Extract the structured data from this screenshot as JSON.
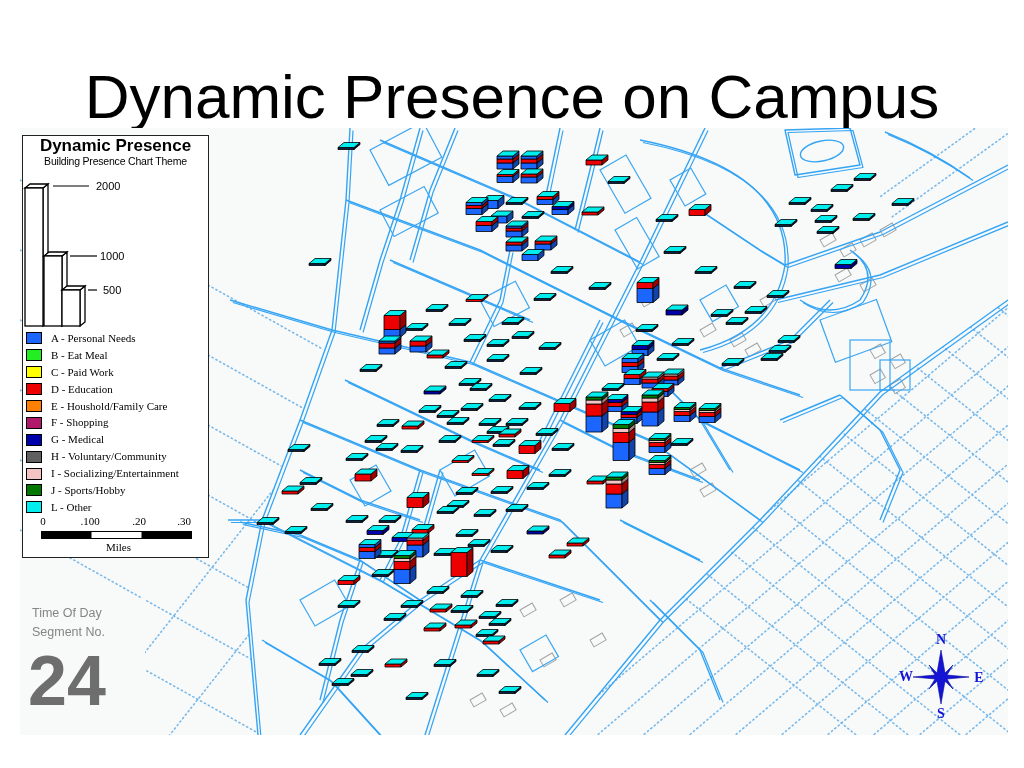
{
  "title": "Dynamic Presence on Campus",
  "legend": {
    "title": "Dynamic Presence",
    "subtitle": "Building Presence Chart Theme",
    "size_scale": [
      "2000",
      "1000",
      "500"
    ],
    "categories": [
      {
        "label": "A - Personal Needs",
        "color": "#1a66ff"
      },
      {
        "label": "B - Eat Meal",
        "color": "#22ee22"
      },
      {
        "label": "C - Paid Work",
        "color": "#ffff00"
      },
      {
        "label": "D - Education",
        "color": "#ee0000"
      },
      {
        "label": "E - Houshold/Family Care",
        "color": "#ff8000"
      },
      {
        "label": "F - Shopping",
        "color": "#b0186a"
      },
      {
        "label": "G - Medical",
        "color": "#0000aa"
      },
      {
        "label": "H - Voluntary/Community",
        "color": "#606060"
      },
      {
        "label": "I - Socializing/Entertainment",
        "color": "#f4c4c4"
      },
      {
        "label": "J - Sports/Hobby",
        "color": "#007800"
      },
      {
        "label": "L - Other",
        "color": "#00eeee"
      }
    ],
    "distance_scale": {
      "ticks": [
        "0",
        ".100",
        ".20",
        ".30"
      ],
      "unit": "Miles"
    }
  },
  "time_segment": {
    "caption": [
      "Time Of Day",
      "Segment No."
    ],
    "number": "24"
  },
  "compass": {
    "north": "N",
    "east": "E",
    "south": "S",
    "west": "W"
  }
}
